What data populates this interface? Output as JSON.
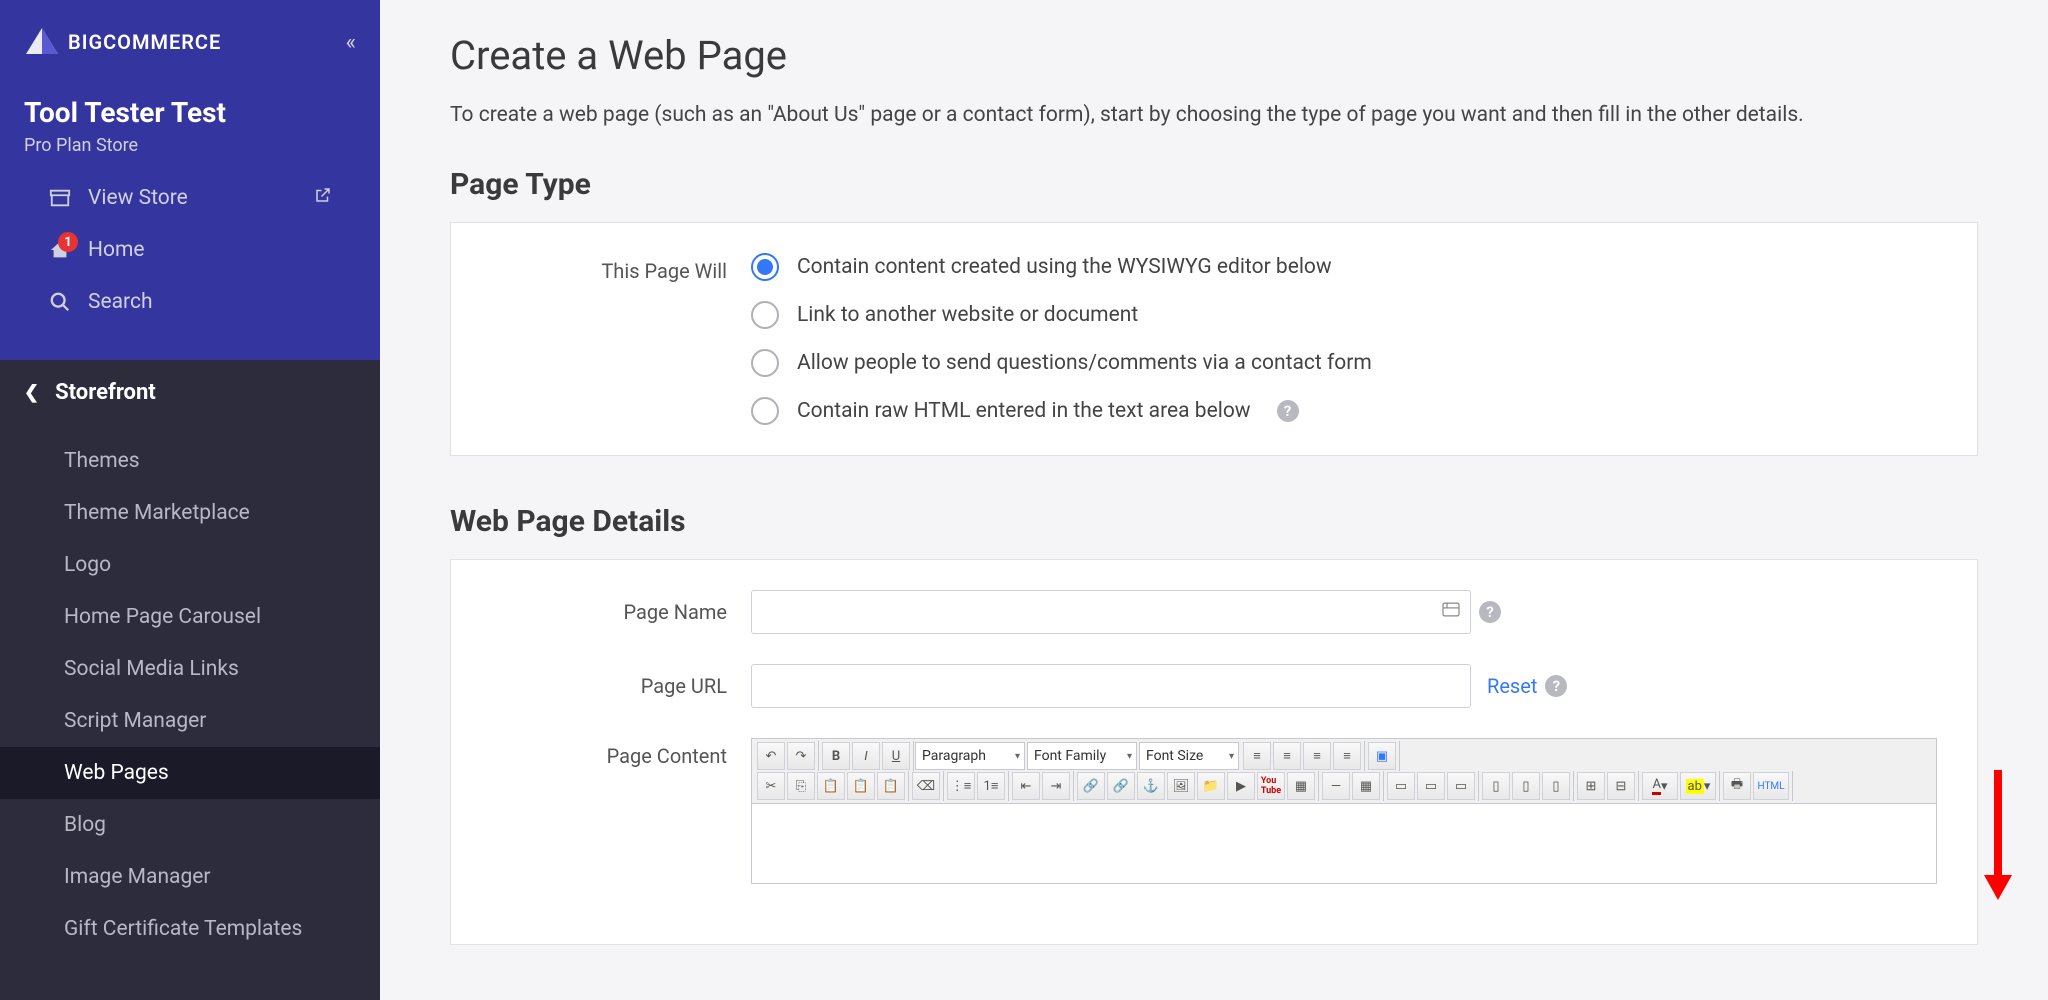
{
  "brand": {
    "name": "BIGCOMMERCE"
  },
  "store": {
    "name": "Tool Tester Test",
    "plan": "Pro Plan Store"
  },
  "topNav": {
    "viewStore": "View Store",
    "home": "Home",
    "homeBadge": "1",
    "search": "Search"
  },
  "sidebar": {
    "sectionTitle": "Storefront",
    "items": [
      "Themes",
      "Theme Marketplace",
      "Logo",
      "Home Page Carousel",
      "Social Media Links",
      "Script Manager",
      "Web Pages",
      "Blog",
      "Image Manager",
      "Gift Certificate Templates"
    ],
    "activeIndex": 6
  },
  "main": {
    "title": "Create a Web Page",
    "description": "To create a web page (such as an \"About Us\" page or a contact form), start by choosing the type of page you want and then fill in the other details."
  },
  "pageType": {
    "heading": "Page Type",
    "label": "This Page Will",
    "options": [
      "Contain content created using the WYSIWYG editor below",
      "Link to another website or document",
      "Allow people to send questions/comments via a contact form",
      "Contain raw HTML entered in the text area below"
    ],
    "selected": 0
  },
  "details": {
    "heading": "Web Page Details",
    "pageNameLabel": "Page Name",
    "pageUrlLabel": "Page URL",
    "resetLabel": "Reset",
    "pageContentLabel": "Page Content"
  },
  "editor": {
    "format": "Paragraph",
    "fontFamily": "Font Family",
    "fontSize": "Font Size",
    "htmlBtn": "HTML"
  }
}
